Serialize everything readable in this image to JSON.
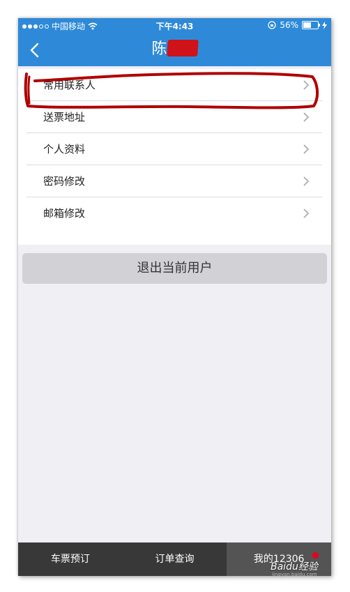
{
  "status_bar": {
    "carrier": "中国移动",
    "time": "下午4:43",
    "battery": "56%",
    "battery_level": 0.56
  },
  "nav": {
    "title_visible": "陈"
  },
  "menu": {
    "items": [
      {
        "label": "常用联系人"
      },
      {
        "label": "送票地址"
      },
      {
        "label": "个人资料"
      },
      {
        "label": "密码修改"
      },
      {
        "label": "邮箱修改"
      }
    ]
  },
  "logout_label": "退出当前用户",
  "tabbar": {
    "tabs": [
      {
        "label": "车票预订"
      },
      {
        "label": "订单查询"
      },
      {
        "label": "我的12306"
      }
    ],
    "active_index": 2
  },
  "watermark": {
    "text": "Baidu经验",
    "url": "jingyan.baidu.com"
  },
  "colors": {
    "nav_blue": "#2e8ad8",
    "annotation_red": "#b00000",
    "badge_red": "#e8001c",
    "tabbar_bg": "#383838"
  }
}
